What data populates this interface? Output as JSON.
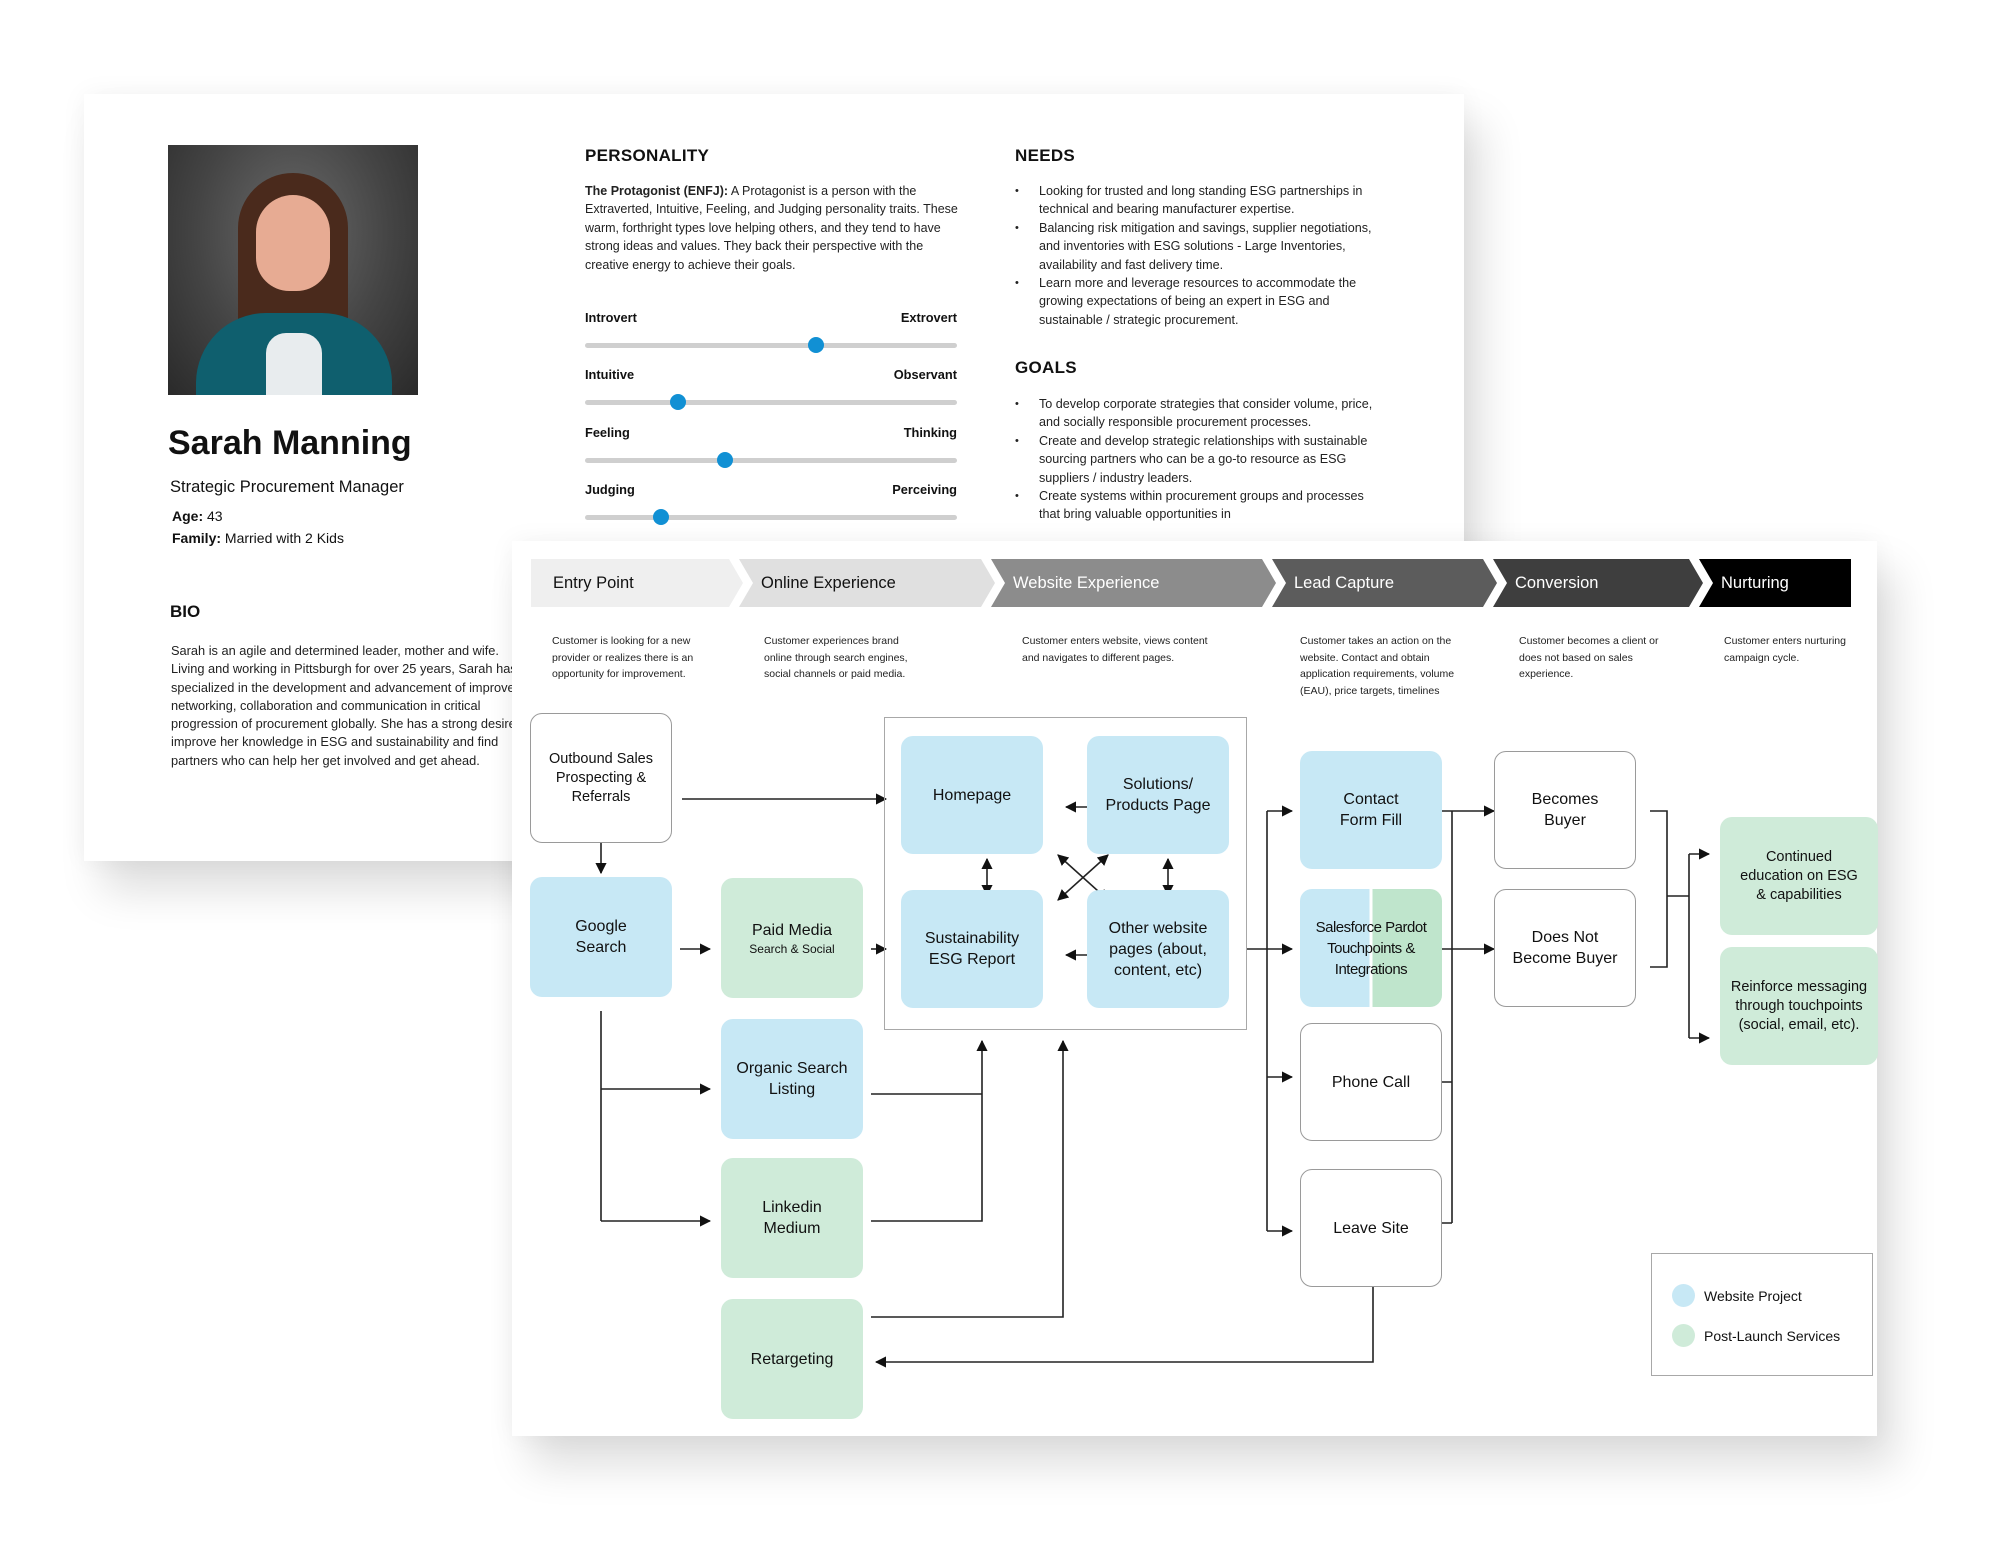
{
  "persona": {
    "name": "Sarah Manning",
    "role": "Strategic Procurement Manager",
    "age_label": "Age:",
    "age": "43",
    "family_label": "Family:",
    "family": "Married with 2 Kids",
    "bio_heading": "BIO",
    "bio": "Sarah is an agile and determined leader, mother and wife. Living and working in Pittsburgh for over 25 years, Sarah has specialized in the development and advancement of improved networking, collaboration and communication in critical progression of procurement globally. She has a strong desire to improve her knowledge in ESG and sustainability and find partners who can help her get involved and get ahead.",
    "photo_icon": "person-portrait",
    "personality": {
      "heading": "PERSONALITY",
      "type_label": "The Protagonist (ENFJ):",
      "description": "A Protagonist is a person with the Extraverted, Intuitive, Feeling, and Judging personality traits. These warm, forthright types love helping others, and they tend to have strong ideas and values. They back their perspective with the creative energy to achieve their goals.",
      "sliders": [
        {
          "left": "Introvert",
          "right": "Extrovert",
          "value": 0.62
        },
        {
          "left": "Intuitive",
          "right": "Observant",
          "value": 0.25
        },
        {
          "left": "Feeling",
          "right": "Thinking",
          "value": 0.375
        },
        {
          "left": "Judging",
          "right": "Perceiving",
          "value": 0.205
        }
      ],
      "slider_color": "#1190d4"
    },
    "needs": {
      "heading": "NEEDS",
      "items": [
        "Looking for trusted and long standing ESG partnerships in technical and bearing manufacturer expertise.",
        "Balancing risk mitigation and savings, supplier negotiations, and inventories with ESG solutions - Large Inventories, availability and fast delivery time.",
        "Learn more and leverage resources to accommodate the growing expectations of being an expert in ESG and sustainable / strategic procurement."
      ]
    },
    "goals": {
      "heading": "GOALS",
      "items": [
        "To develop corporate strategies that consider volume, price, and socially responsible procurement processes.",
        "Create and develop strategic relationships with sustainable sourcing partners who can be a go-to resource as ESG suppliers / industry leaders.",
        "Create systems within procurement groups and processes that bring valuable opportunities in"
      ]
    }
  },
  "journey": {
    "stages": [
      {
        "label": "Entry Point",
        "desc": "Customer is looking for a new provider or realizes there is an opportunity for improvement.",
        "bg": "#efefef",
        "fg": "#111111"
      },
      {
        "label": "Online Experience",
        "desc": "Customer experiences brand online through search engines, social channels or paid media.",
        "bg": "#e0e0e0",
        "fg": "#111111"
      },
      {
        "label": "Website Experience",
        "desc": "Customer enters website, views content and navigates to different pages.",
        "bg": "#8c8c8c",
        "fg": "#ffffff"
      },
      {
        "label": "Lead Capture",
        "desc": "Customer takes an action on the website. Contact and obtain application requirements, volume (EAU), price targets, timelines",
        "bg": "#5c5c5c",
        "fg": "#ffffff"
      },
      {
        "label": "Conversion",
        "desc": "Customer becomes a client or does not based on sales experience.",
        "bg": "#3e3e3e",
        "fg": "#ffffff"
      },
      {
        "label": "Nurturing",
        "desc": "Customer enters nurturing campaign cycle.",
        "bg": "#000000",
        "fg": "#ffffff"
      }
    ],
    "nodes": {
      "outbound": "Outbound Sales Prospecting & Referrals",
      "google": "Google Search",
      "paid_media": "Paid Media",
      "paid_media_sub": "Search & Social",
      "organic": "Organic Search Listing",
      "linkedin": "Linkedin Medium",
      "retargeting": "Retargeting",
      "homepage": "Homepage",
      "solutions": "Solutions/ Products Page",
      "sustainability": "Sustainability ESG Report",
      "other_pages": "Other website pages (about, content, etc)",
      "contact": "Contact Form Fill",
      "salesforce": "Salesforce Pardot Touchpoints & Integrations",
      "phone": "Phone Call",
      "leave": "Leave Site",
      "becomes_buyer": "Becomes Buyer",
      "not_buyer": "Does Not Become Buyer",
      "continued": "Continued education on ESG & capabilities",
      "reinforce": "Reinforce messaging through touchpoints (social, email, etc)."
    },
    "legend": [
      {
        "label": "Website Project",
        "color": "#c7e8f5"
      },
      {
        "label": "Post-Launch Services",
        "color": "#cfebd9"
      }
    ]
  }
}
